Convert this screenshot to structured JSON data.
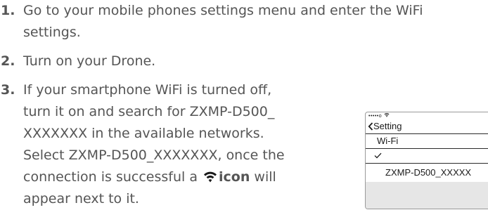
{
  "steps": [
    {
      "number": "1.",
      "lines": [
        "Go to your mobile phones settings menu and enter the WiFi",
        "settings."
      ]
    },
    {
      "number": "2.",
      "lines": [
        "Turn on your Drone."
      ]
    },
    {
      "number": "3.",
      "lines": [
        "If your smartphone WiFi is turned off,",
        "turn it on and search for ZXMP-D500_",
        "XXXXXXX in the available networks.",
        "Select ZXMP-D500_XXXXXXX, once the"
      ],
      "icon_line_before": "connection is successful a",
      "icon_name": "wifi-icon",
      "icon_word": "icon",
      "icon_line_after": "will",
      "last_line": "appear next to it."
    }
  ],
  "phone": {
    "status_dots": "•••••o",
    "status_icon": "wifi-icon",
    "back_label": "Setting",
    "wifi_label": "Wi-Fi",
    "check_icon": "checkmark-icon",
    "network_label": "ZXMP-D500_XXXXX"
  },
  "colors": {
    "text": "#555555",
    "phone_text": "#1a1a1a",
    "phone_footer": "#e6e6e6"
  }
}
